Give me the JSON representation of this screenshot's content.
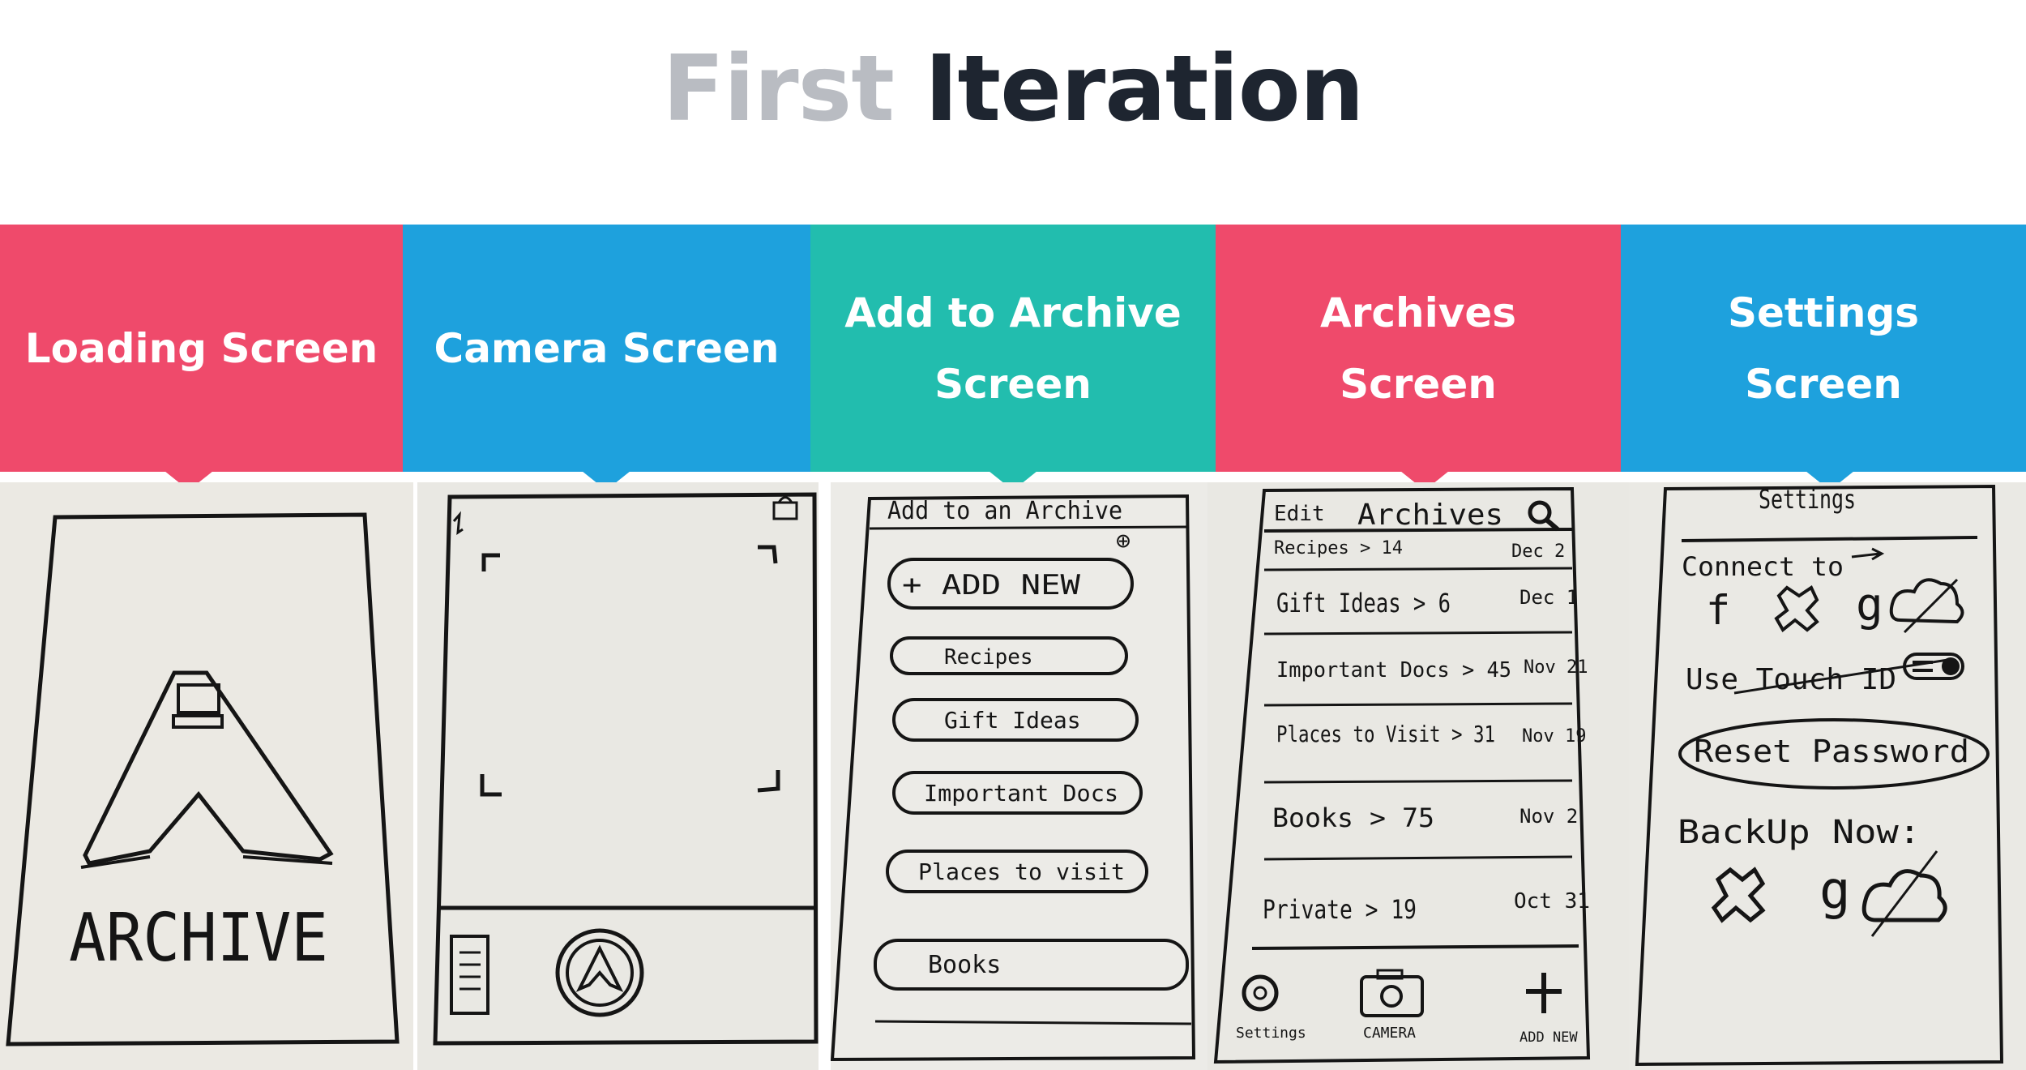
{
  "title": {
    "first": "First",
    "second": "Iteration"
  },
  "colors": {
    "red": "#ef4a6b",
    "blue": "#1ea1dd",
    "teal": "#22bdae",
    "title_gray": "#b9bcc2",
    "title_dark": "#1e2530"
  },
  "screens": [
    {
      "label": "Loading Screen",
      "sketch": {
        "logo_text": "ARCHIVE"
      }
    },
    {
      "label": "Camera Screen",
      "sketch": {}
    },
    {
      "label": "Add to Archive Screen",
      "sketch": {
        "heading": "Add to an Archive",
        "plus": "⊕",
        "add_new": "+ ADD NEW",
        "items": [
          "Recipes",
          "Gift Ideas",
          "Important Docs",
          "Places to visit",
          "Books"
        ]
      }
    },
    {
      "label": "Archives Screen",
      "sketch": {
        "edit": "Edit",
        "heading": "Archives",
        "rows": [
          {
            "name": "Recipes > 14",
            "date": "Dec 2"
          },
          {
            "name": "Gift Ideas > 6",
            "date": "Dec 1"
          },
          {
            "name": "Important Docs > 45",
            "date": "Nov 21"
          },
          {
            "name": "Places to Visit > 31",
            "date": "Nov 19"
          },
          {
            "name": "Books > 75",
            "date": "Nov 2"
          },
          {
            "name": "Private > 19",
            "date": "Oct 31"
          }
        ],
        "tabs": [
          "Settings",
          "CAMERA",
          "ADD NEW"
        ]
      }
    },
    {
      "label": "Settings Screen",
      "sketch": {
        "heading": "Settings",
        "connect": "Connect to",
        "connect_f": "f",
        "connect_g": "g",
        "touch_id": "Use Touch ID",
        "reset": "Reset Password",
        "backup": "BackUp Now:",
        "backup_g": "g"
      }
    }
  ]
}
